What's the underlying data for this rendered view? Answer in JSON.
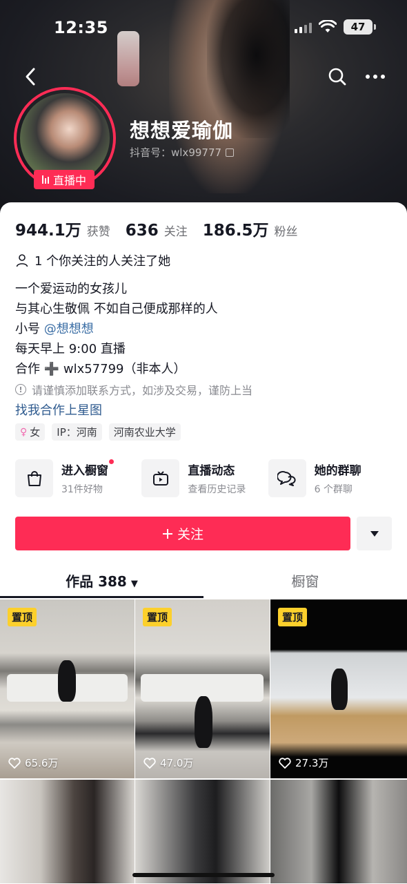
{
  "status_bar": {
    "time": "12:35",
    "battery": "47"
  },
  "profile": {
    "nickname": "想想爱瑜伽",
    "douyin_id": "抖音号：wlx99777",
    "live_badge": "直播中"
  },
  "stats": [
    {
      "value": "944.1万",
      "label": "获赞"
    },
    {
      "value": "636",
      "label": "关注"
    },
    {
      "value": "186.5万",
      "label": "粉丝"
    }
  ],
  "mutual_follow": "1 个你关注的人关注了她",
  "bio": {
    "line1": "一个爱运动的女孩儿",
    "line2": "与其心生敬佩 不如自己便成那样的人",
    "line3_prefix": "小号 ",
    "line3_mention": "@想想想",
    "line4": "每天早上 9:00 直播",
    "line5": "合作 ➕ wlx57799（非本人）"
  },
  "warning": "请谨慎添加联系方式，如涉及交易，谨防上当",
  "starmap_link": "找我合作上星图",
  "tags": [
    {
      "label": "女",
      "icon": "female-icon"
    },
    {
      "label": "IP：河南"
    },
    {
      "label": "河南农业大学"
    }
  ],
  "features": [
    {
      "title": "进入橱窗",
      "subtitle": "31件好物",
      "icon": "shopping-bag-icon"
    },
    {
      "title": "直播动态",
      "subtitle": "查看历史记录",
      "icon": "tv-icon"
    },
    {
      "title": "她的群聊",
      "subtitle": "6 个群聊",
      "icon": "chat-bubbles-icon"
    }
  ],
  "follow_button": "关注",
  "tabs": {
    "works": "作品 388",
    "shop": "橱窗"
  },
  "grid": [
    {
      "pinned": "置顶",
      "likes": "65.6万"
    },
    {
      "pinned": "置顶",
      "likes": "47.0万"
    },
    {
      "pinned": "置顶",
      "likes": "27.3万"
    }
  ],
  "colors": {
    "accent": "#fe2c55",
    "pin": "#fcd02c",
    "link": "#2f5b8f"
  }
}
